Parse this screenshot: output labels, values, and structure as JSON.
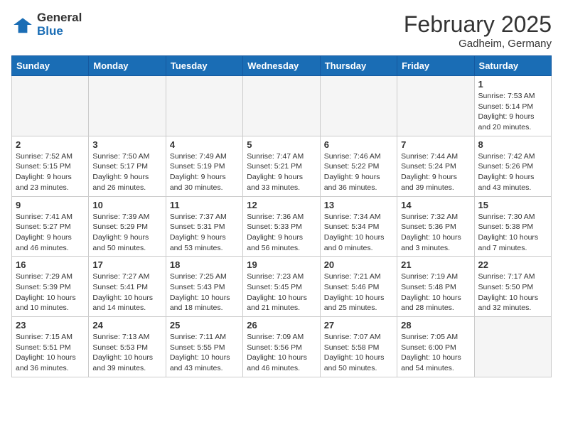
{
  "logo": {
    "general": "General",
    "blue": "Blue"
  },
  "title": "February 2025",
  "subtitle": "Gadheim, Germany",
  "weekdays": [
    "Sunday",
    "Monday",
    "Tuesday",
    "Wednesday",
    "Thursday",
    "Friday",
    "Saturday"
  ],
  "weeks": [
    [
      {
        "day": "",
        "info": ""
      },
      {
        "day": "",
        "info": ""
      },
      {
        "day": "",
        "info": ""
      },
      {
        "day": "",
        "info": ""
      },
      {
        "day": "",
        "info": ""
      },
      {
        "day": "",
        "info": ""
      },
      {
        "day": "1",
        "info": "Sunrise: 7:53 AM\nSunset: 5:14 PM\nDaylight: 9 hours and 20 minutes."
      }
    ],
    [
      {
        "day": "2",
        "info": "Sunrise: 7:52 AM\nSunset: 5:15 PM\nDaylight: 9 hours and 23 minutes."
      },
      {
        "day": "3",
        "info": "Sunrise: 7:50 AM\nSunset: 5:17 PM\nDaylight: 9 hours and 26 minutes."
      },
      {
        "day": "4",
        "info": "Sunrise: 7:49 AM\nSunset: 5:19 PM\nDaylight: 9 hours and 30 minutes."
      },
      {
        "day": "5",
        "info": "Sunrise: 7:47 AM\nSunset: 5:21 PM\nDaylight: 9 hours and 33 minutes."
      },
      {
        "day": "6",
        "info": "Sunrise: 7:46 AM\nSunset: 5:22 PM\nDaylight: 9 hours and 36 minutes."
      },
      {
        "day": "7",
        "info": "Sunrise: 7:44 AM\nSunset: 5:24 PM\nDaylight: 9 hours and 39 minutes."
      },
      {
        "day": "8",
        "info": "Sunrise: 7:42 AM\nSunset: 5:26 PM\nDaylight: 9 hours and 43 minutes."
      }
    ],
    [
      {
        "day": "9",
        "info": "Sunrise: 7:41 AM\nSunset: 5:27 PM\nDaylight: 9 hours and 46 minutes."
      },
      {
        "day": "10",
        "info": "Sunrise: 7:39 AM\nSunset: 5:29 PM\nDaylight: 9 hours and 50 minutes."
      },
      {
        "day": "11",
        "info": "Sunrise: 7:37 AM\nSunset: 5:31 PM\nDaylight: 9 hours and 53 minutes."
      },
      {
        "day": "12",
        "info": "Sunrise: 7:36 AM\nSunset: 5:33 PM\nDaylight: 9 hours and 56 minutes."
      },
      {
        "day": "13",
        "info": "Sunrise: 7:34 AM\nSunset: 5:34 PM\nDaylight: 10 hours and 0 minutes."
      },
      {
        "day": "14",
        "info": "Sunrise: 7:32 AM\nSunset: 5:36 PM\nDaylight: 10 hours and 3 minutes."
      },
      {
        "day": "15",
        "info": "Sunrise: 7:30 AM\nSunset: 5:38 PM\nDaylight: 10 hours and 7 minutes."
      }
    ],
    [
      {
        "day": "16",
        "info": "Sunrise: 7:29 AM\nSunset: 5:39 PM\nDaylight: 10 hours and 10 minutes."
      },
      {
        "day": "17",
        "info": "Sunrise: 7:27 AM\nSunset: 5:41 PM\nDaylight: 10 hours and 14 minutes."
      },
      {
        "day": "18",
        "info": "Sunrise: 7:25 AM\nSunset: 5:43 PM\nDaylight: 10 hours and 18 minutes."
      },
      {
        "day": "19",
        "info": "Sunrise: 7:23 AM\nSunset: 5:45 PM\nDaylight: 10 hours and 21 minutes."
      },
      {
        "day": "20",
        "info": "Sunrise: 7:21 AM\nSunset: 5:46 PM\nDaylight: 10 hours and 25 minutes."
      },
      {
        "day": "21",
        "info": "Sunrise: 7:19 AM\nSunset: 5:48 PM\nDaylight: 10 hours and 28 minutes."
      },
      {
        "day": "22",
        "info": "Sunrise: 7:17 AM\nSunset: 5:50 PM\nDaylight: 10 hours and 32 minutes."
      }
    ],
    [
      {
        "day": "23",
        "info": "Sunrise: 7:15 AM\nSunset: 5:51 PM\nDaylight: 10 hours and 36 minutes."
      },
      {
        "day": "24",
        "info": "Sunrise: 7:13 AM\nSunset: 5:53 PM\nDaylight: 10 hours and 39 minutes."
      },
      {
        "day": "25",
        "info": "Sunrise: 7:11 AM\nSunset: 5:55 PM\nDaylight: 10 hours and 43 minutes."
      },
      {
        "day": "26",
        "info": "Sunrise: 7:09 AM\nSunset: 5:56 PM\nDaylight: 10 hours and 46 minutes."
      },
      {
        "day": "27",
        "info": "Sunrise: 7:07 AM\nSunset: 5:58 PM\nDaylight: 10 hours and 50 minutes."
      },
      {
        "day": "28",
        "info": "Sunrise: 7:05 AM\nSunset: 6:00 PM\nDaylight: 10 hours and 54 minutes."
      },
      {
        "day": "",
        "info": ""
      }
    ]
  ]
}
